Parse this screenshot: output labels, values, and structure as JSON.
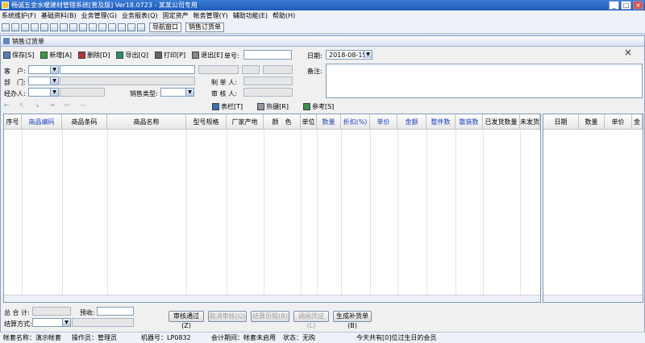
{
  "window": {
    "title": "畅诚五金水暖建材管理系统[普及版] Ver18.0723 - 某某公司专用",
    "minimize": "_",
    "maximize": "□",
    "close": "×"
  },
  "menu": [
    "系统维护(F)",
    "基础资料(B)",
    "业务管理(G)",
    "业务报表(Q)",
    "固定资产",
    "帐务管理(Y)",
    "辅助功能(E)",
    "帮助(H)"
  ],
  "toolbar": {
    "nav_label": "导航窗口",
    "tab_label": "销售订货单"
  },
  "child": {
    "title": "销售订货单",
    "close": "×"
  },
  "actions": {
    "save": "保存[S]",
    "add": "新增[A]",
    "delete": "删除[D]",
    "export": "导出[Q]",
    "print": "打印[P]",
    "exit": "退出[E]"
  },
  "form": {
    "doc_no_label": "单号:",
    "date_label": "日期:",
    "date_value": "2018-08-15",
    "customer_label": "客　户:",
    "dept_label": "部　门:",
    "agent_label": "经办人:",
    "sale_type_label": "销售类型:",
    "maker_label": "制 单 人:",
    "reviewer_label": "审 核 人:",
    "remark_label": "备注:"
  },
  "gridtools": {
    "table_label": "表栏[T]",
    "hotkey_label": "热键[R]",
    "ref_label": "参考[S]"
  },
  "columns": [
    "序号",
    "商品编码",
    "商品条码",
    "商品名称",
    "型号规格",
    "厂家产地",
    "颜　色",
    "单位",
    "数量",
    "折扣(%)",
    "单价",
    "金额",
    "整件数",
    "散装数",
    "已发货数量",
    "未发货"
  ],
  "side_columns": [
    "日期",
    "数量",
    "单价",
    "金"
  ],
  "footer": {
    "total_label": "总 合 计:",
    "prepay_label": "预收:",
    "settle_label": "结算方式:"
  },
  "buttons": {
    "approve": "审核通过(Z)",
    "cancel_approve": "取消审核(Q)",
    "settle_history": "结算历程(B)",
    "adjust_voucher": "调阅凭证(L)",
    "gen_restock": "生成补货单(B)"
  },
  "statusbar": {
    "account": "帐套名称：演示帐套",
    "operator": "操作员：管理员",
    "machine": "机器号：LP0832",
    "period": "会计期间：帐套未启用",
    "state": "状态：无购",
    "birthday": "今天共有[0]位过生日的会员"
  }
}
